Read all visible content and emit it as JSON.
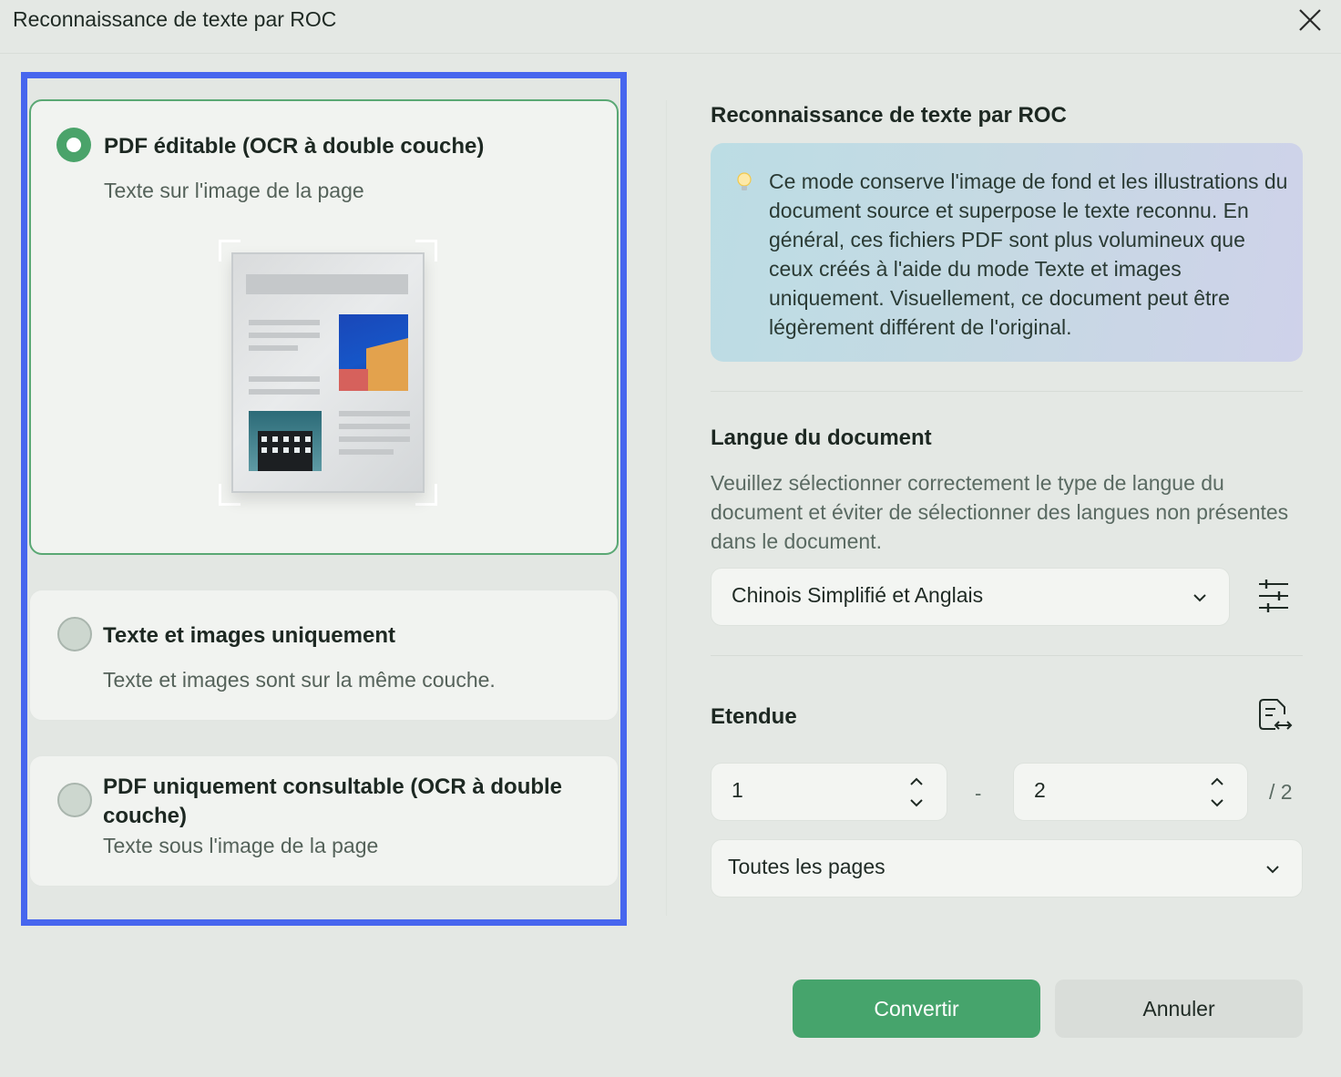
{
  "window": {
    "title": "Reconnaissance de texte par ROC"
  },
  "modes": [
    {
      "title": "PDF éditable (OCR à double couche)",
      "subtitle": "Texte sur l'image de la page",
      "selected": true
    },
    {
      "title": "Texte et images uniquement",
      "subtitle": "Texte et images sont sur la même couche.",
      "selected": false
    },
    {
      "title": "PDF uniquement consultable (OCR à double couche)",
      "subtitle": "Texte sous l'image de la page",
      "selected": false
    }
  ],
  "ocr_section": {
    "title": "Reconnaissance de texte par ROC",
    "info": "Ce mode conserve l'image de fond et les illustrations du document source et superpose le texte reconnu. En général, ces fichiers PDF sont plus volumineux que ceux créés à l'aide du mode Texte et images uniquement. Visuellement, ce document peut être légèrement différent de l'original."
  },
  "language": {
    "title": "Langue du document",
    "description": "Veuillez sélectionner correctement le type de langue du document et éviter de sélectionner des langues non présentes dans le document.",
    "selected": "Chinois Simplifié et Anglais"
  },
  "range": {
    "title": "Etendue",
    "from": "1",
    "separator": "-",
    "to": "2",
    "total": "/ 2",
    "pages_option": "Toutes les pages"
  },
  "buttons": {
    "convert": "Convertir",
    "cancel": "Annuler"
  },
  "colors": {
    "accent": "#46a46c",
    "selection_outline": "#4766ee"
  }
}
